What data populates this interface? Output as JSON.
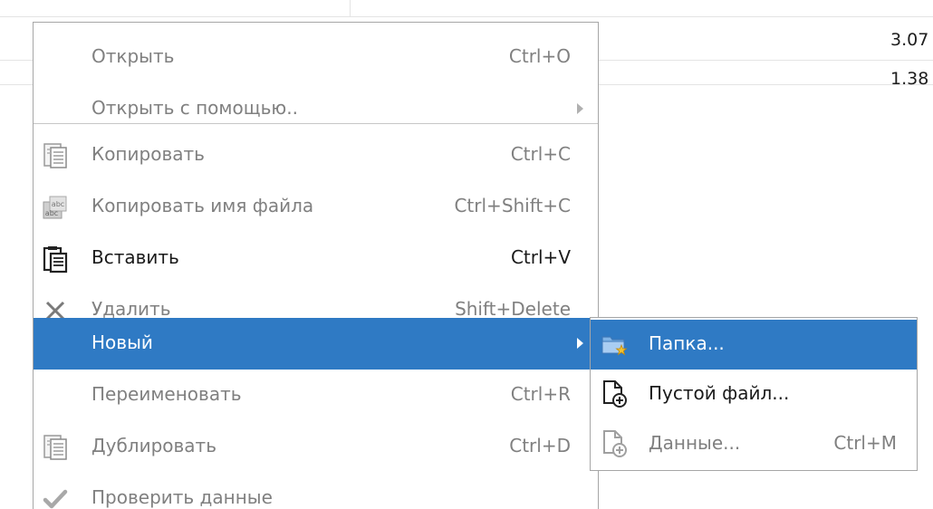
{
  "background_table": {
    "values": [
      "3.07",
      "1.38"
    ]
  },
  "context_menu": {
    "items": [
      {
        "label": "Открыть",
        "shortcut": "Ctrl+O",
        "enabled": false,
        "icon": "none"
      },
      {
        "label": "Открыть с помощью..",
        "shortcut": "",
        "enabled": false,
        "submenu": true,
        "icon": "none"
      },
      {
        "label": "Копировать",
        "shortcut": "Ctrl+C",
        "enabled": false,
        "icon": "copy-icon"
      },
      {
        "label": "Копировать имя файла",
        "shortcut": "Ctrl+Shift+C",
        "enabled": false,
        "icon": "copy-filename-icon"
      },
      {
        "label": "Вставить",
        "shortcut": "Ctrl+V",
        "enabled": true,
        "icon": "paste-icon"
      },
      {
        "label": "Удалить",
        "shortcut": "Shift+Delete",
        "enabled": false,
        "icon": "delete-icon"
      },
      {
        "label": "Новый",
        "shortcut": "",
        "enabled": true,
        "selected": true,
        "submenu": true,
        "icon": "none"
      },
      {
        "label": "Переименовать",
        "shortcut": "Ctrl+R",
        "enabled": false,
        "icon": "none"
      },
      {
        "label": "Дублировать",
        "shortcut": "Ctrl+D",
        "enabled": false,
        "icon": "duplicate-icon"
      },
      {
        "label": "Проверить данные",
        "shortcut": "",
        "enabled": false,
        "icon": "checkmark-icon"
      }
    ]
  },
  "new_submenu": {
    "items": [
      {
        "label": "Папка...",
        "shortcut": "",
        "enabled": true,
        "selected": true,
        "icon": "new-folder-icon"
      },
      {
        "label": "Пустой файл...",
        "shortcut": "",
        "enabled": true,
        "icon": "new-file-icon"
      },
      {
        "label": "Данные...",
        "shortcut": "Ctrl+M",
        "enabled": false,
        "icon": "new-data-icon"
      }
    ]
  },
  "colors": {
    "selection": "#2f7ac4",
    "disabled_text": "#808080",
    "enabled_text": "#1a1a1a",
    "menu_border": "#a6a6a6"
  }
}
